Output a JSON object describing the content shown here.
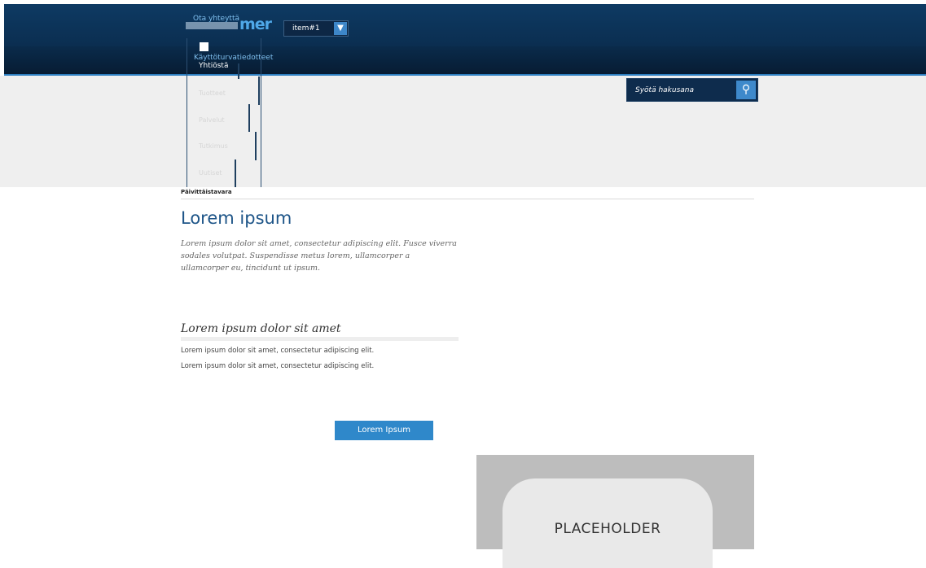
{
  "header": {
    "logo_text": "mer",
    "nav": [
      {
        "label": "Ota yhteyttä"
      },
      {
        "label": "Käyttöturvatiedotteet"
      }
    ],
    "menu": {
      "first_item": "Yhtiöstä",
      "faded_items": [
        "Tuotteet",
        "Palvelut",
        "Tutkimus",
        "Uutiset"
      ]
    },
    "select": {
      "value": "item#1",
      "options": [
        "item#1"
      ]
    }
  },
  "search": {
    "placeholder": "Syötä hakusana"
  },
  "content": {
    "breadcrumb": "Päivittäistavara",
    "title": "Lorem ipsum",
    "intro": "Lorem ipsum dolor sit amet, consectetur adipiscing elit. Fusce viverra sodales volutpat. Suspendisse metus lorem, ullamcorper a ullamcorper eu, tincidunt ut ipsum.",
    "subtitle": "Lorem ipsum dolor sit amet",
    "lines": [
      "Lorem ipsum dolor sit amet, consectetur adipiscing elit.",
      "Lorem ipsum dolor sit amet, consectetur adipiscing elit."
    ],
    "button_label": "Lorem Ipsum",
    "placeholder": "PLACEHOLDER"
  },
  "colors": {
    "header": "#0b2f52",
    "accent": "#2f88ca",
    "title": "#1e5588",
    "page_background": "#efefef"
  }
}
